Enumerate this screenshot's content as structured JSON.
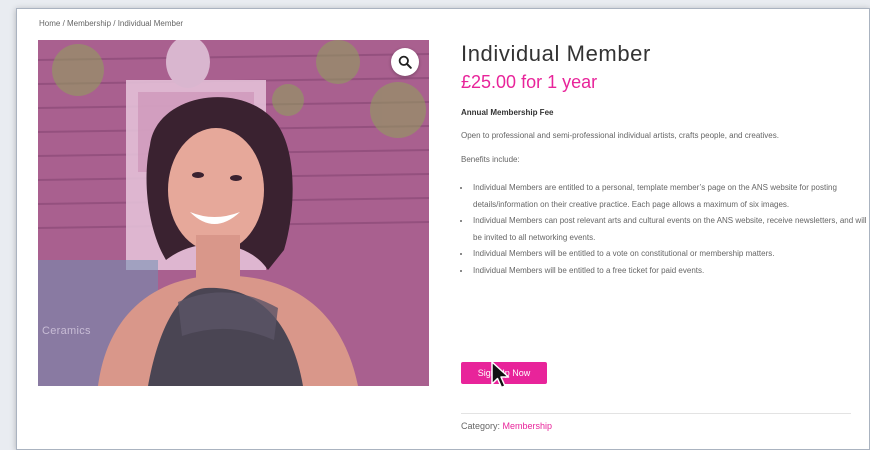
{
  "breadcrumb": "Home / Membership / Individual Member",
  "product": {
    "title": "Individual Member",
    "price": "£25.00",
    "period": " for 1 year",
    "subheading": "Annual Membership Fee",
    "description": "Open to professional and semi-professional individual artists, crafts people, and creatives.",
    "benefits_intro": "Benefits include:",
    "benefits": [
      "Individual Members are entitled to a personal, template member’s page on the ANS website for posting details/information on their creative practice. Each page allows a maximum of six images.",
      "Individual Members can post relevant arts and cultural events on the ANS website, receive newsletters, and will be invited to all networking events.",
      "Individual Members will be entitled to a vote on constitutional or membership matters.",
      "Individual Members will be entitled to a free ticket for paid events."
    ],
    "signup_label": "Sign Up Now",
    "category_label": "Category: ",
    "category_value": "Membership"
  },
  "image": {
    "caption_text": "Ceramics",
    "zoom_icon": "magnifier-icon"
  },
  "colors": {
    "accent": "#e8249a",
    "text": "#333333",
    "muted": "#666666"
  }
}
